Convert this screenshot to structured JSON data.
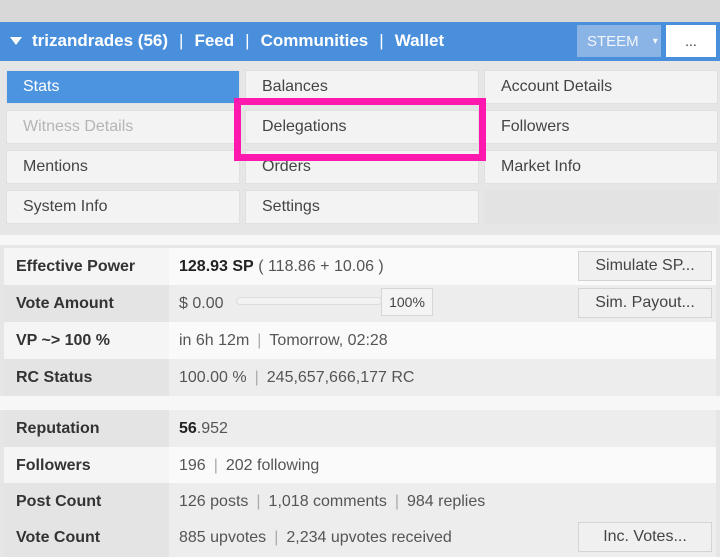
{
  "header": {
    "username_label": "trizandrades (56)",
    "nav": [
      "Feed",
      "Communities",
      "Wallet"
    ],
    "separator": "|",
    "network_select": "STEEM",
    "more_button": "..."
  },
  "menu": {
    "items": [
      {
        "label": "Stats",
        "state": "active"
      },
      {
        "label": "Balances",
        "state": "normal"
      },
      {
        "label": "Account Details",
        "state": "normal"
      },
      {
        "label": "Witness Details",
        "state": "disabled"
      },
      {
        "label": "Delegations",
        "state": "highlighted"
      },
      {
        "label": "Followers",
        "state": "normal"
      },
      {
        "label": "Mentions",
        "state": "normal"
      },
      {
        "label": "Orders",
        "state": "normal"
      },
      {
        "label": "Market Info",
        "state": "normal"
      },
      {
        "label": "System Info",
        "state": "normal"
      },
      {
        "label": "Settings",
        "state": "normal"
      }
    ],
    "highlight_color": "#ff18ad",
    "active_color": "#4d94e0"
  },
  "stats": {
    "effective_power": {
      "label": "Effective Power",
      "value": "128.93 SP",
      "detail": "( 118.86 + 10.06 )",
      "button": "Simulate SP..."
    },
    "vote_amount": {
      "label": "Vote Amount",
      "value": "$ 0.00",
      "percent": "100%",
      "slider_fraction": 1.0,
      "button": "Sim. Payout..."
    },
    "vp": {
      "label": "VP ~> 100 %",
      "eta": "in 6h 12m",
      "time": "Tomorrow, 02:28"
    },
    "rc_status": {
      "label": "RC Status",
      "percent": "100.00 %",
      "rc": "245,657,666,177 RC"
    },
    "reputation": {
      "label": "Reputation",
      "value_int": "56",
      "value_dec": ".952"
    },
    "followers": {
      "label": "Followers",
      "count": "196",
      "following": "202 following"
    },
    "post_count": {
      "label": "Post Count",
      "posts": "126 posts",
      "comments": "1,018 comments",
      "replies": "984 replies"
    },
    "vote_count": {
      "label": "Vote Count",
      "upvotes": "885 upvotes",
      "received": "2,234 upvotes received",
      "button": "Inc. Votes..."
    }
  },
  "colors": {
    "header_bar": "#4a8fdc"
  }
}
